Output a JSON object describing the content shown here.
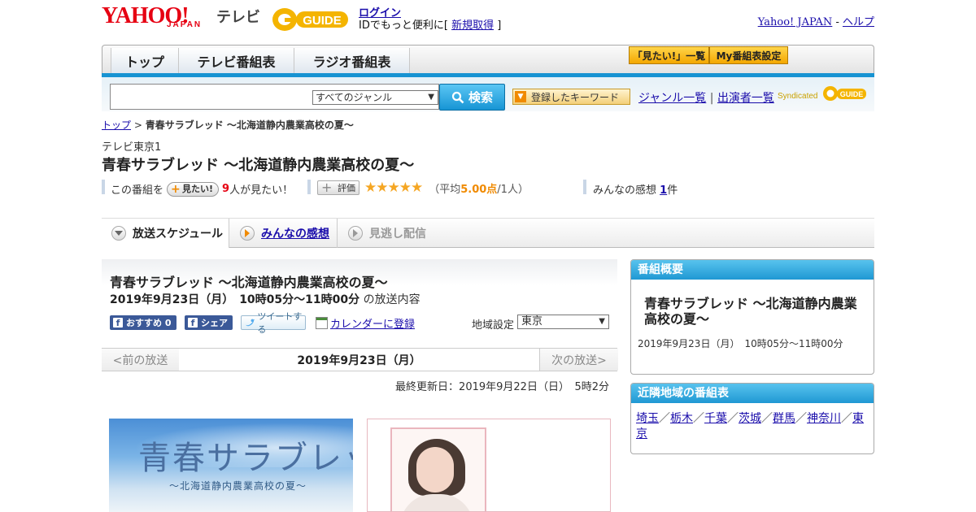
{
  "header": {
    "yahoo_logo": "YAHOO!",
    "japan_logo": "JAPAN",
    "tv_label": "テレビ",
    "gguide_logo": "G GUIDE",
    "login_link": "ログイン",
    "login_sub_prefix": "IDでもっと便利に[ ",
    "signup_link": "新規取得",
    "login_sub_suffix": " ]",
    "yahoo_japan_link": "Yahoo! JAPAN",
    "separator": " - ",
    "help_link": "ヘルプ"
  },
  "nav": {
    "tabs": [
      "トップ",
      "テレビ番組表",
      "ラジオ番組表"
    ],
    "mitai_list_btn": "「見たい!」一覧",
    "my_schedule_btn": "My番組表設定"
  },
  "search": {
    "query": "",
    "genre_selected": "すべてのジャンル",
    "search_btn": "検索",
    "keyword_btn": "登録したキーワード",
    "genre_list_link": "ジャンル一覧",
    "divider": " | ",
    "performer_list_link": "出演者一覧",
    "syndicated_label": "Syndicated",
    "syndicated_logo": "GUIDE"
  },
  "breadcrumb": {
    "top": "トップ",
    "sep": " > ",
    "current": "青春サラブレッド ～北海道静内農業高校の夏～"
  },
  "program": {
    "channel": "テレビ東京1",
    "title": "青春サラブレッド ～北海道静内農業高校の夏～"
  },
  "stats": {
    "prefix": "この番組を",
    "mitai_btn": "見たい!",
    "count": "9",
    "suffix": "人が見たい！",
    "rate_btn": "評価",
    "stars": "★★★★★",
    "avg_open": "（平均",
    "avg_value": "5.00点",
    "avg_close": "/1人）",
    "impressions_label": "みんなの感想 ",
    "impressions_count": "1",
    "impressions_unit": "件"
  },
  "tabs": {
    "schedule": "放送スケジュール",
    "impressions": "みんなの感想",
    "streaming": "見逃し配信"
  },
  "broadcast": {
    "title": "青春サラブレッド ～北海道静内農業高校の夏～",
    "datetime": "2019年9月23日（月）　10時05分～11時00分",
    "datetime_suffix": " の放送内容",
    "fb_recommend": "おすすめ 0",
    "fb_share": "シェア",
    "tweet": "ツイートする",
    "calendar": "カレンダーに登録",
    "region_label": "地域設定",
    "region_value": "東京",
    "prev": "<前の放送",
    "current_date": "2019年9月23日（月）",
    "next": "次の放送>",
    "last_updated": "最終更新日：2019年9月22日（日）　5時2分",
    "image_title": "青春サラブレッド",
    "image_subtitle": "～北海道静内農業高校の夏～"
  },
  "sidebar": {
    "overview_head": "番組概要",
    "overview_title": "青春サラブレッド ～北海道静内農業高校の夏～",
    "overview_date": "2019年9月23日（月）　10時05分～11時00分",
    "nearby_head": "近隣地域の番組表",
    "nearby": [
      "埼玉",
      "栃木",
      "千葉",
      "茨城",
      "群馬",
      "神奈川",
      "東京"
    ],
    "nearby_sep": "／"
  },
  "colors": {
    "accent_blue": "#1f98d3",
    "brand_red": "#e60012",
    "star": "#f5a623",
    "orange": "#f08a00"
  }
}
